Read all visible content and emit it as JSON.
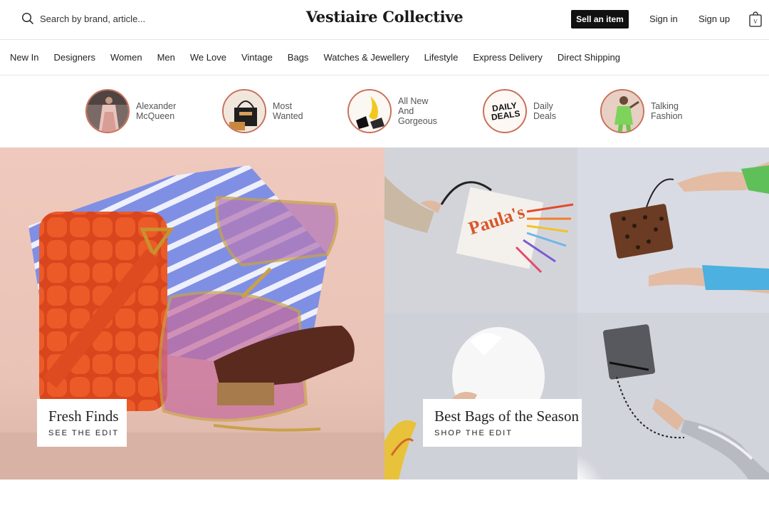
{
  "header": {
    "search_placeholder": "Search by brand, article...",
    "logo": "Vestiaire Collective",
    "sell_label": "Sell an item",
    "sign_in_label": "Sign in",
    "sign_up_label": "Sign up"
  },
  "nav": {
    "items": [
      {
        "label": "New In"
      },
      {
        "label": "Designers"
      },
      {
        "label": "Women"
      },
      {
        "label": "Men"
      },
      {
        "label": "We Love"
      },
      {
        "label": "Vintage"
      },
      {
        "label": "Bags"
      },
      {
        "label": "Watches & Jewellery"
      },
      {
        "label": "Lifestyle"
      },
      {
        "label": "Express Delivery"
      },
      {
        "label": "Direct Shipping"
      }
    ]
  },
  "stories": [
    {
      "label": "Alexander\nMcQueen"
    },
    {
      "label": "Most\nWanted"
    },
    {
      "label": "All New\nAnd\nGorgeous"
    },
    {
      "label": "Daily\nDeals",
      "badge": "DAILY\nDEALS"
    },
    {
      "label": "Talking\nFashion"
    }
  ],
  "hero": {
    "left": {
      "title": "Fresh Finds",
      "cta": "SEE THE EDIT"
    },
    "right": {
      "title": "Best Bags of the Season",
      "cta": "SHOP THE EDIT"
    },
    "bag_print": "Paula's"
  },
  "colors": {
    "accent_ring": "#c9705a",
    "sell_button": "#111111"
  }
}
